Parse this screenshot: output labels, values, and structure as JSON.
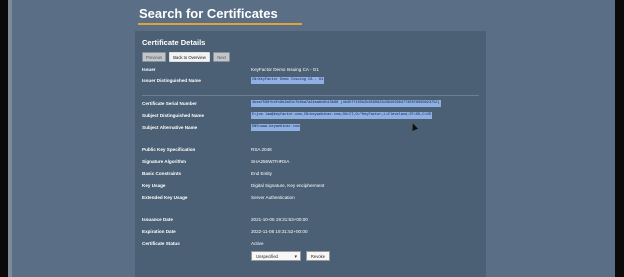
{
  "page": {
    "title": "Search for Certificates"
  },
  "panel": {
    "title": "Certificate Details",
    "buttons": {
      "previous": "Previous",
      "back": "Back to Overview",
      "next": "Next"
    }
  },
  "fields": {
    "issuer": {
      "label": "Issuer",
      "value": "KeyFactor Demo Issuing CA - G1"
    },
    "issuer_dn": {
      "label": "Issuer Distinguished Name",
      "value": "CN=KeyFactor Demo Issuing CA - G1"
    },
    "serial": {
      "label": "Certificate Serial Number",
      "value": "4bea7568+b4fc8b2a01c7b6ba7a24aa6c6b13b68 (4b45f7105b2b6590823d3640398477305f6090823752)"
    },
    "subject_dn": {
      "label": "Subject Distinguished Name",
      "value": "E=joe.law@keyfactor.com,CN=keywebinar.com,OU=IT,O=\"KeyFactor,L=Cleveland,ST=OH,C=US"
    },
    "subject_alt": {
      "label": "Subject Alternative Name",
      "value": "DNS=www.keywebinar.com"
    },
    "key_spec": {
      "label": "Public Key Specification",
      "value": "RSA 2048"
    },
    "sig_alg": {
      "label": "Signature Algorithm",
      "value": "SHA256WITHRSA"
    },
    "basic_constraints": {
      "label": "Basic Constraints",
      "value": "End Entity"
    },
    "key_usage": {
      "label": "Key Usage",
      "value": "Digital Signature, Key encipherment"
    },
    "ext_key_usage": {
      "label": "Extended Key Usage",
      "value": "Server Authentication"
    },
    "issuance_date": {
      "label": "Issuance Date",
      "value": "2021-10-05 19:31:53+00:00"
    },
    "expiration_date": {
      "label": "Expiration Date",
      "value": "2022-11-06 19:31:52+00:00"
    },
    "status": {
      "label": "Certificate Status",
      "value": "Active"
    }
  },
  "actions": {
    "reason_selected": "Unspecified",
    "revoke": "Revoke"
  },
  "icons": {
    "dropdown": "chevron-down-icon",
    "cursor": "mouse-cursor-icon"
  },
  "colors": {
    "accent": "#e0a23a",
    "selection": "#8fb0e3",
    "panel": "#4b6075",
    "background": "#5a6f85"
  }
}
